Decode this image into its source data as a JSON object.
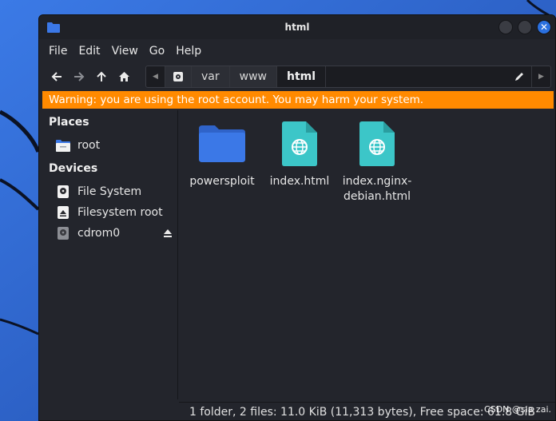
{
  "window": {
    "title": "html"
  },
  "menubar": {
    "items": [
      "File",
      "Edit",
      "View",
      "Go",
      "Help"
    ]
  },
  "toolbar": {
    "back_icon": "back-arrow-icon",
    "forward_icon": "forward-arrow-icon",
    "up_icon": "up-arrow-icon",
    "home_icon": "home-icon"
  },
  "pathbar": {
    "crumbs": [
      "var",
      "www",
      "html"
    ],
    "active": "html"
  },
  "warning": {
    "text": "Warning: you are using the root account. You may harm your system."
  },
  "sidebar": {
    "places_heading": "Places",
    "places": [
      {
        "label": "root",
        "icon": "home-folder-icon"
      }
    ],
    "devices_heading": "Devices",
    "devices": [
      {
        "label": "File System",
        "icon": "drive-icon"
      },
      {
        "label": "Filesystem root",
        "icon": "drive-icon"
      },
      {
        "label": "cdrom0",
        "icon": "optical-drive-icon",
        "ejectable": true
      }
    ]
  },
  "files": [
    {
      "name": "powersploit",
      "type": "folder",
      "icon": "folder-icon"
    },
    {
      "name": "index.html",
      "type": "html",
      "icon": "html-file-icon"
    },
    {
      "name": "index.nginx-debian.html",
      "type": "html",
      "icon": "html-file-icon",
      "label_lines": [
        "index.nginx-",
        "debian.html"
      ]
    }
  ],
  "statusbar": {
    "text": "1 folder, 2 files: 11.0 KiB (11,313 bytes), Free space: 61.8 GiB"
  },
  "watermark": {
    "text": "CSDN @sia zai."
  },
  "colors": {
    "warning_bg": "#ff8a00",
    "window_bg": "#23252c",
    "accent": "#2a70e0",
    "folder": "#3b78e7",
    "html_file": "#3cc6c8"
  }
}
